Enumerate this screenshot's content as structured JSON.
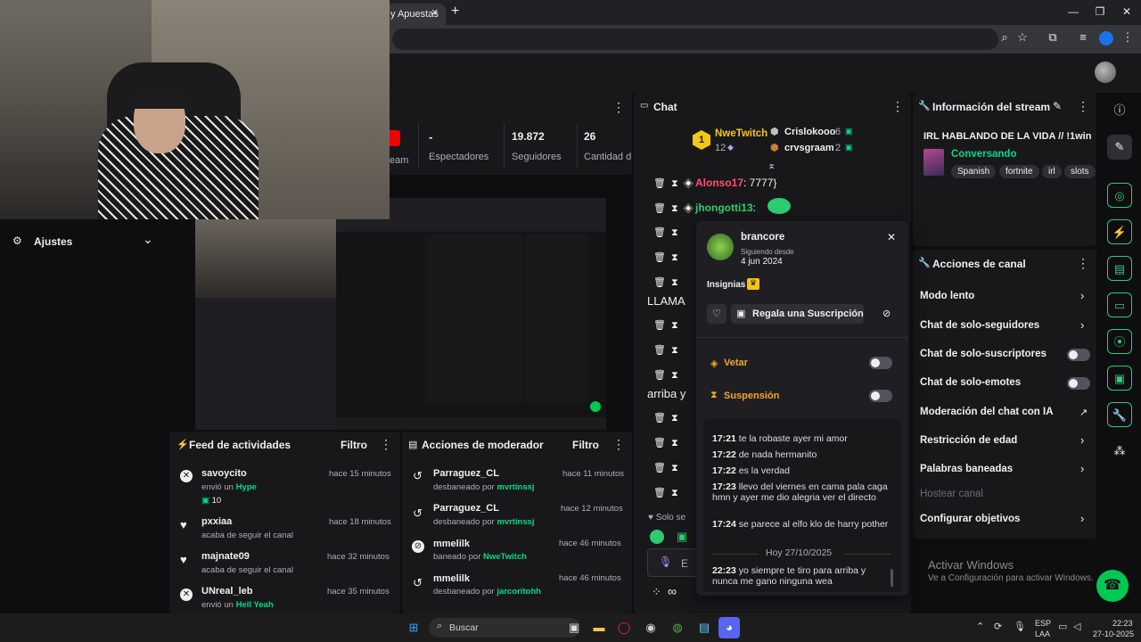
{
  "browser": {
    "tab_title": "y Apuestas",
    "tab_close": "×",
    "new_tab": "+",
    "win_min": "—",
    "win_max": "❐",
    "win_close": "✕"
  },
  "sidebar": {
    "settings_label": "Ajustes",
    "partial_label": "..."
  },
  "stats": {
    "live_badge": "",
    "stream_label": "eam",
    "viewers_value": "-",
    "viewers_label": "Espectadores",
    "followers_value": "19.872",
    "followers_label": "Seguidores",
    "subs_value": "26",
    "subs_label": "Cantidad d"
  },
  "activity_feed": {
    "title": "Feed de actividades",
    "filter": "Filtro",
    "items": [
      {
        "user": "savoycito",
        "desc_prefix": "envió un",
        "desc_highlight": "Hype",
        "extra": "10",
        "time": "hace 15 minutos"
      },
      {
        "user": "pxxiaa",
        "desc_prefix": "acaba de seguir el canal",
        "desc_highlight": "",
        "extra": "",
        "time": "hace 18 minutos"
      },
      {
        "user": "majnate09",
        "desc_prefix": "acaba de seguir el canal",
        "desc_highlight": "",
        "extra": "",
        "time": "hace 32 minutos"
      },
      {
        "user": "UNreal_leb",
        "desc_prefix": "envió un",
        "desc_highlight": "Hell Yeah",
        "extra": "",
        "time": "hace 35 minutos"
      }
    ]
  },
  "mod_actions": {
    "title": "Acciones de moderador",
    "filter": "Filtro",
    "items": [
      {
        "user": "Parraguez_CL",
        "desc_prefix": "desbaneado por",
        "by": "mvrtinssj",
        "time": "hace 11 minutos"
      },
      {
        "user": "Parraguez_CL",
        "desc_prefix": "desbaneado por",
        "by": "mvrtinssj",
        "time": "hace 12 minutos"
      },
      {
        "user": "mmelilk",
        "desc_prefix": "baneado por",
        "by": "NweTwitch",
        "time": "hace 46 minutos"
      },
      {
        "user": "mmelilk",
        "desc_prefix": "desbaneado por",
        "by": "jarcoritohh",
        "time": "hace 46 minutos"
      }
    ]
  },
  "chat": {
    "title": "Chat",
    "leaderboard": {
      "first_rank": "1",
      "first_name": "NweTwitch",
      "first_count": "12",
      "second_name": "Crislokooo",
      "second_count": "6",
      "third_name": "crvsgraam",
      "third_count": "2"
    },
    "messages": [
      {
        "user": "Alonso17",
        "text": ": 7777}"
      },
      {
        "user": "jhongotti13",
        "text": ":"
      }
    ],
    "partial_lines": [
      "LLAMA",
      "arriba y"
    ],
    "only_subs_partial": "Solo se",
    "input_partial": "E",
    "infinity": "∞"
  },
  "user_card": {
    "username": "brancore",
    "following_label": "Siguiendo desde",
    "following_date": "4 jun 2024",
    "badges_label": "Insignias",
    "gift_label": "Regala una Suscripción",
    "ban_label": "Vetar",
    "timeout_label": "Suspensión",
    "messages": [
      {
        "time": "17:21",
        "text": "te la robaste ayer mi amor"
      },
      {
        "time": "17:22",
        "text": "de nada hermanito"
      },
      {
        "time": "17:22",
        "text": "es la verdad"
      },
      {
        "time": "17:23",
        "text": "llevo del viernes en cama pala caga hmn y ayer me dio alegria ver el directo"
      },
      {
        "time": "17:24",
        "text": "se parece al elfo klo de harry pother"
      }
    ],
    "date_divider": "Hoy 27/10/2025",
    "last_message": {
      "time": "22:23",
      "text": "yo siempre te tiro para arriba y nunca me gano ninguna wea"
    }
  },
  "stream_info": {
    "title": "Información del stream",
    "stream_title": "IRL HABLANDO DE LA VIDA // !1win",
    "category": "Conversando",
    "tags": [
      "Spanish",
      "fortnite",
      "irl",
      "slots"
    ]
  },
  "channel_actions": {
    "title": "Acciones de canal",
    "items": [
      {
        "label": "Modo lento",
        "control": "chevron"
      },
      {
        "label": "Chat de solo-seguidores",
        "control": "chevron"
      },
      {
        "label": "Chat de solo-suscriptores",
        "control": "toggle"
      },
      {
        "label": "Chat de solo-emotes",
        "control": "toggle"
      },
      {
        "label": "Moderación del chat con IA",
        "control": "external"
      },
      {
        "label": "Restricción de edad",
        "control": "chevron"
      },
      {
        "label": "Palabras baneadas",
        "control": "chevron"
      },
      {
        "label": "Hostear canal",
        "control": "none"
      },
      {
        "label": "Configurar objetivos",
        "control": "chevron"
      }
    ]
  },
  "windows_watermark": {
    "title": "Activar Windows",
    "subtitle": "Ve a Configuración para activar Windows."
  },
  "taskbar": {
    "search_placeholder": "Buscar",
    "language": "ESP",
    "layout": "LAA",
    "time": "22:23",
    "date": "27-10-2025"
  },
  "colors": {
    "accent_green": "#00db84",
    "background": "#0e0e10",
    "panel": "#18181b",
    "chat_user_red": "#ff4f6d",
    "chat_user_green": "#2ecc71"
  }
}
